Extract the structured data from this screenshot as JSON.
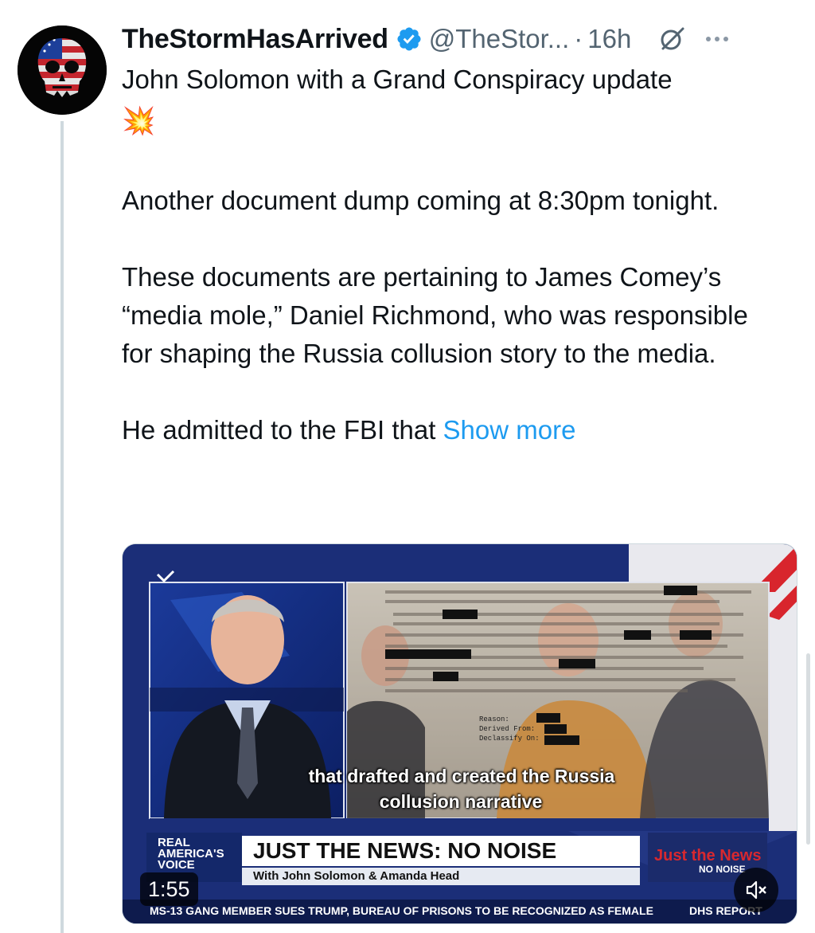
{
  "author": {
    "display_name": "TheStormHasArrived",
    "handle": "@TheStor...",
    "separator": "·",
    "time_ago": "16h",
    "verified": true
  },
  "tweet": {
    "line1": "John Solomon with a Grand Conspiracy update",
    "emoji": "💥",
    "para2": "Another document dump coming at 8:30pm tonight.",
    "para3": "These documents are pertaining to James Comey’s “media mole,” Daniel Richmond, who was responsible for shaping the Russia collusion story to the media.",
    "para4_prefix": "He admitted to the FBI that ",
    "show_more": "Show more"
  },
  "video": {
    "duration": "1:55",
    "caption_line1": "that drafted and created the Russia",
    "caption_line2": "collusion narrative",
    "channel_logo": [
      "REAL",
      "AMERICA'S",
      "VOICE"
    ],
    "headline": "JUST THE NEWS: NO NOISE",
    "subline": "With John Solomon & Amanda Head",
    "brand": "Just the News",
    "brand_sub": "NO NOISE",
    "crawl_left": "MS-13 GANG MEMBER SUES TRUMP, BUREAU OF PRISONS TO BE RECOGNIZED AS FEMALE",
    "crawl_right": "DHS REPORT"
  },
  "icons": {
    "verified": "verified-badge-icon",
    "grok": "grok-icon",
    "more": "more-options-icon",
    "mute": "muted-speaker-icon"
  },
  "colors": {
    "link": "#1d9bf0",
    "verified": "#1d9bf0",
    "secondary_text": "#536471"
  }
}
